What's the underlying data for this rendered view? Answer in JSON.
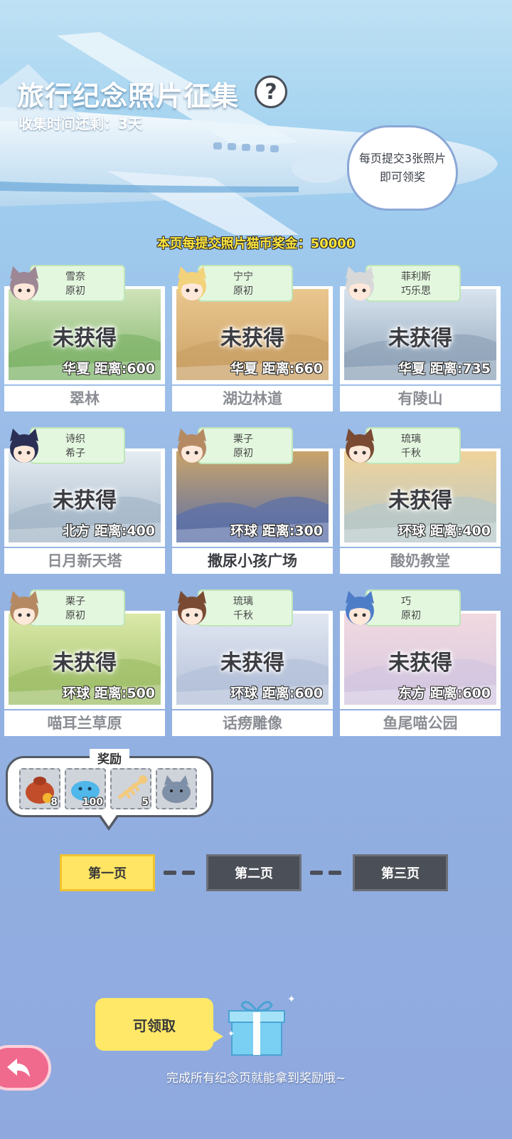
{
  "header": {
    "title": "旅行纪念照片征集",
    "help_icon": "question-mark-icon",
    "timer": "收集时间还剩：3天",
    "bubble_line1": "每页提交3张照片",
    "bubble_line2": "即可领奖",
    "page_bonus": "本页每提交照片猫币奖金：50000"
  },
  "cards": [
    {
      "tag1": "雪奈",
      "tag2": "原初",
      "status": "未获得",
      "distance": "华夏  距离:600",
      "place": "翠林",
      "active": false
    },
    {
      "tag1": "宁宁",
      "tag2": "原初",
      "status": "未获得",
      "distance": "华夏  距离:660",
      "place": "湖边林道",
      "active": false
    },
    {
      "tag1": "菲利斯",
      "tag2": "巧乐思",
      "status": "未获得",
      "distance": "华夏  距离:735",
      "place": "有陵山",
      "active": false
    },
    {
      "tag1": "诗织",
      "tag2": "希子",
      "status": "未获得",
      "distance": "北方  距离:400",
      "place": "日月新天塔",
      "active": false
    },
    {
      "tag1": "栗子",
      "tag2": "原初",
      "status": "",
      "distance": "环球  距离:300",
      "place": "撒尿小孩广场",
      "active": true
    },
    {
      "tag1": "琉璃",
      "tag2": "千秋",
      "status": "未获得",
      "distance": "环球  距离:400",
      "place": "酸奶教堂",
      "active": false
    },
    {
      "tag1": "栗子",
      "tag2": "原初",
      "status": "未获得",
      "distance": "环球  距离:500",
      "place": "喵耳兰草原",
      "active": false
    },
    {
      "tag1": "琉璃",
      "tag2": "千秋",
      "status": "未获得",
      "distance": "环球  距离:600",
      "place": "话痨雕像",
      "active": false
    },
    {
      "tag1": "巧",
      "tag2": "原初",
      "status": "未获得",
      "distance": "东方  距离:600",
      "place": "鱼尾喵公园",
      "active": false
    }
  ],
  "rewards": {
    "title": "奖励",
    "items": [
      {
        "icon": "gold-coin-bag-icon",
        "count": "8"
      },
      {
        "icon": "blue-slime-fish-icon",
        "count": "100"
      },
      {
        "icon": "fish-bone-icon",
        "count": "5"
      },
      {
        "icon": "gray-cat-icon",
        "count": ""
      }
    ]
  },
  "pagination": {
    "pages": [
      "第一页",
      "第二页",
      "第三页"
    ],
    "current": 0
  },
  "bottom": {
    "claim_label": "可领取",
    "gift_icon": "gift-box-icon",
    "note": "完成所有纪念页就能拿到奖励哦~",
    "back_icon": "back-arrow-icon"
  },
  "colors": {
    "accent_yellow": "#ffe563",
    "tag_green": "#e3f7df",
    "dark_button": "#4b4f57",
    "back_pink": "#f06a8e"
  }
}
